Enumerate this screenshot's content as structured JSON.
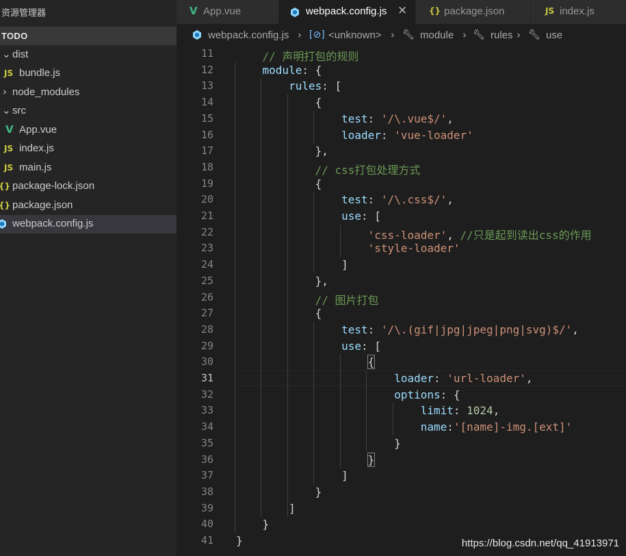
{
  "sidebar": {
    "header": "资源管理器",
    "section": "TODO",
    "items": [
      {
        "label": "dist",
        "type": "folder",
        "open": true
      },
      {
        "label": "bundle.js",
        "type": "js",
        "icon": "JS"
      },
      {
        "label": "node_modules",
        "type": "folder",
        "open": false
      },
      {
        "label": "src",
        "type": "folder",
        "open": true
      },
      {
        "label": "App.vue",
        "type": "vue",
        "icon": "V"
      },
      {
        "label": "index.js",
        "type": "js",
        "icon": "JS"
      },
      {
        "label": "main.js",
        "type": "js",
        "icon": "JS"
      },
      {
        "label": "package-lock.json",
        "type": "json",
        "icon": "{}"
      },
      {
        "label": "package.json",
        "type": "json",
        "icon": "{}"
      },
      {
        "label": "webpack.config.js",
        "type": "webpack",
        "selected": true
      }
    ]
  },
  "tabs": [
    {
      "label": "App.vue",
      "icon": "V",
      "active": false
    },
    {
      "label": "webpack.config.js",
      "active": true,
      "close": "×"
    },
    {
      "label": "package.json",
      "icon": "{}",
      "active": false
    },
    {
      "label": "index.js",
      "icon": "JS",
      "active": false
    }
  ],
  "breadcrumb": [
    "webpack.config.js",
    "<unknown>",
    "module",
    "rules",
    "use"
  ],
  "colors": {
    "js": "#cbcb41",
    "vue": "#41b883",
    "json": "#cbcb41",
    "webpack": "#8dd6f9"
  },
  "code": [
    {
      "n": "11",
      "t": [
        [
          "    ",
          "p"
        ],
        [
          "// 声明打包的规则",
          "c"
        ]
      ]
    },
    {
      "n": "12",
      "t": [
        [
          "    ",
          "p"
        ],
        [
          "module",
          "k"
        ],
        [
          ": {",
          "p"
        ]
      ]
    },
    {
      "n": "13",
      "t": [
        [
          "        ",
          "p"
        ],
        [
          "rules",
          "k"
        ],
        [
          ": [",
          "p"
        ]
      ]
    },
    {
      "n": "14",
      "t": [
        [
          "            {",
          "p"
        ]
      ]
    },
    {
      "n": "15",
      "t": [
        [
          "                ",
          "p"
        ],
        [
          "test",
          "k"
        ],
        [
          ": ",
          "p"
        ],
        [
          "'/\\.vue$/'",
          "s"
        ],
        [
          ",",
          "p"
        ]
      ]
    },
    {
      "n": "16",
      "t": [
        [
          "                ",
          "p"
        ],
        [
          "loader",
          "k"
        ],
        [
          ": ",
          "p"
        ],
        [
          "'vue-loader'",
          "s"
        ]
      ]
    },
    {
      "n": "17",
      "t": [
        [
          "            },",
          "p"
        ]
      ]
    },
    {
      "n": "18",
      "t": [
        [
          "            ",
          "p"
        ],
        [
          "// css打包处理方式",
          "c"
        ]
      ]
    },
    {
      "n": "19",
      "t": [
        [
          "            {",
          "p"
        ]
      ]
    },
    {
      "n": "20",
      "t": [
        [
          "                ",
          "p"
        ],
        [
          "test",
          "k"
        ],
        [
          ": ",
          "p"
        ],
        [
          "'/\\.css$/'",
          "s"
        ],
        [
          ",",
          "p"
        ]
      ]
    },
    {
      "n": "21",
      "t": [
        [
          "                ",
          "p"
        ],
        [
          "use",
          "k"
        ],
        [
          ": [",
          "p"
        ]
      ]
    },
    {
      "n": "22",
      "t": [
        [
          "                    ",
          "p"
        ],
        [
          "'css-loader'",
          "s"
        ],
        [
          ", ",
          "p"
        ],
        [
          "//只是起到读出css的作用",
          "c"
        ]
      ]
    },
    {
      "n": "23",
      "t": [
        [
          "                    ",
          "p"
        ],
        [
          "'style-loader'",
          "s"
        ]
      ]
    },
    {
      "n": "24",
      "t": [
        [
          "                ]",
          "p"
        ]
      ]
    },
    {
      "n": "25",
      "t": [
        [
          "            },",
          "p"
        ]
      ]
    },
    {
      "n": "26",
      "t": [
        [
          "            ",
          "p"
        ],
        [
          "// 图片打包",
          "c"
        ]
      ]
    },
    {
      "n": "27",
      "t": [
        [
          "            {",
          "p"
        ]
      ]
    },
    {
      "n": "28",
      "t": [
        [
          "                ",
          "p"
        ],
        [
          "test",
          "k"
        ],
        [
          ": ",
          "p"
        ],
        [
          "'/\\.(gif|jpg|jpeg|png|svg)$/'",
          "s"
        ],
        [
          ",",
          "p"
        ]
      ]
    },
    {
      "n": "29",
      "t": [
        [
          "                ",
          "p"
        ],
        [
          "use",
          "k"
        ],
        [
          ": [",
          "p"
        ]
      ]
    },
    {
      "n": "30",
      "t": [
        [
          "                    ",
          "p"
        ],
        [
          "{",
          "b"
        ]
      ]
    },
    {
      "n": "31",
      "t": [
        [
          "                        ",
          "p"
        ],
        [
          "loader",
          "k"
        ],
        [
          ": ",
          "p"
        ],
        [
          "'url-loader'",
          "s"
        ],
        [
          ",",
          "p"
        ]
      ]
    },
    {
      "n": "32",
      "t": [
        [
          "                        ",
          "p"
        ],
        [
          "options",
          "k"
        ],
        [
          ": {",
          "p"
        ]
      ]
    },
    {
      "n": "33",
      "t": [
        [
          "                            ",
          "p"
        ],
        [
          "limit",
          "k"
        ],
        [
          ": ",
          "p"
        ],
        [
          "1024",
          "n"
        ],
        [
          ",",
          "p"
        ]
      ]
    },
    {
      "n": "34",
      "t": [
        [
          "                            ",
          "p"
        ],
        [
          "name",
          "k"
        ],
        [
          ":",
          "p"
        ],
        [
          "'[name]-img.[ext]'",
          "s"
        ]
      ]
    },
    {
      "n": "35",
      "t": [
        [
          "                        }",
          "p"
        ]
      ]
    },
    {
      "n": "36",
      "t": [
        [
          "                    ",
          "p"
        ],
        [
          "}",
          "b"
        ]
      ]
    },
    {
      "n": "37",
      "t": [
        [
          "                ]",
          "p"
        ]
      ]
    },
    {
      "n": "38",
      "t": [
        [
          "            }",
          "p"
        ]
      ]
    },
    {
      "n": "39",
      "t": [
        [
          "        ]",
          "p"
        ]
      ]
    },
    {
      "n": "40",
      "t": [
        [
          "    }",
          "p"
        ]
      ]
    },
    {
      "n": "41",
      "t": [
        [
          "}",
          "p"
        ]
      ]
    }
  ],
  "watermark": "https://blog.csdn.net/qq_41913971"
}
